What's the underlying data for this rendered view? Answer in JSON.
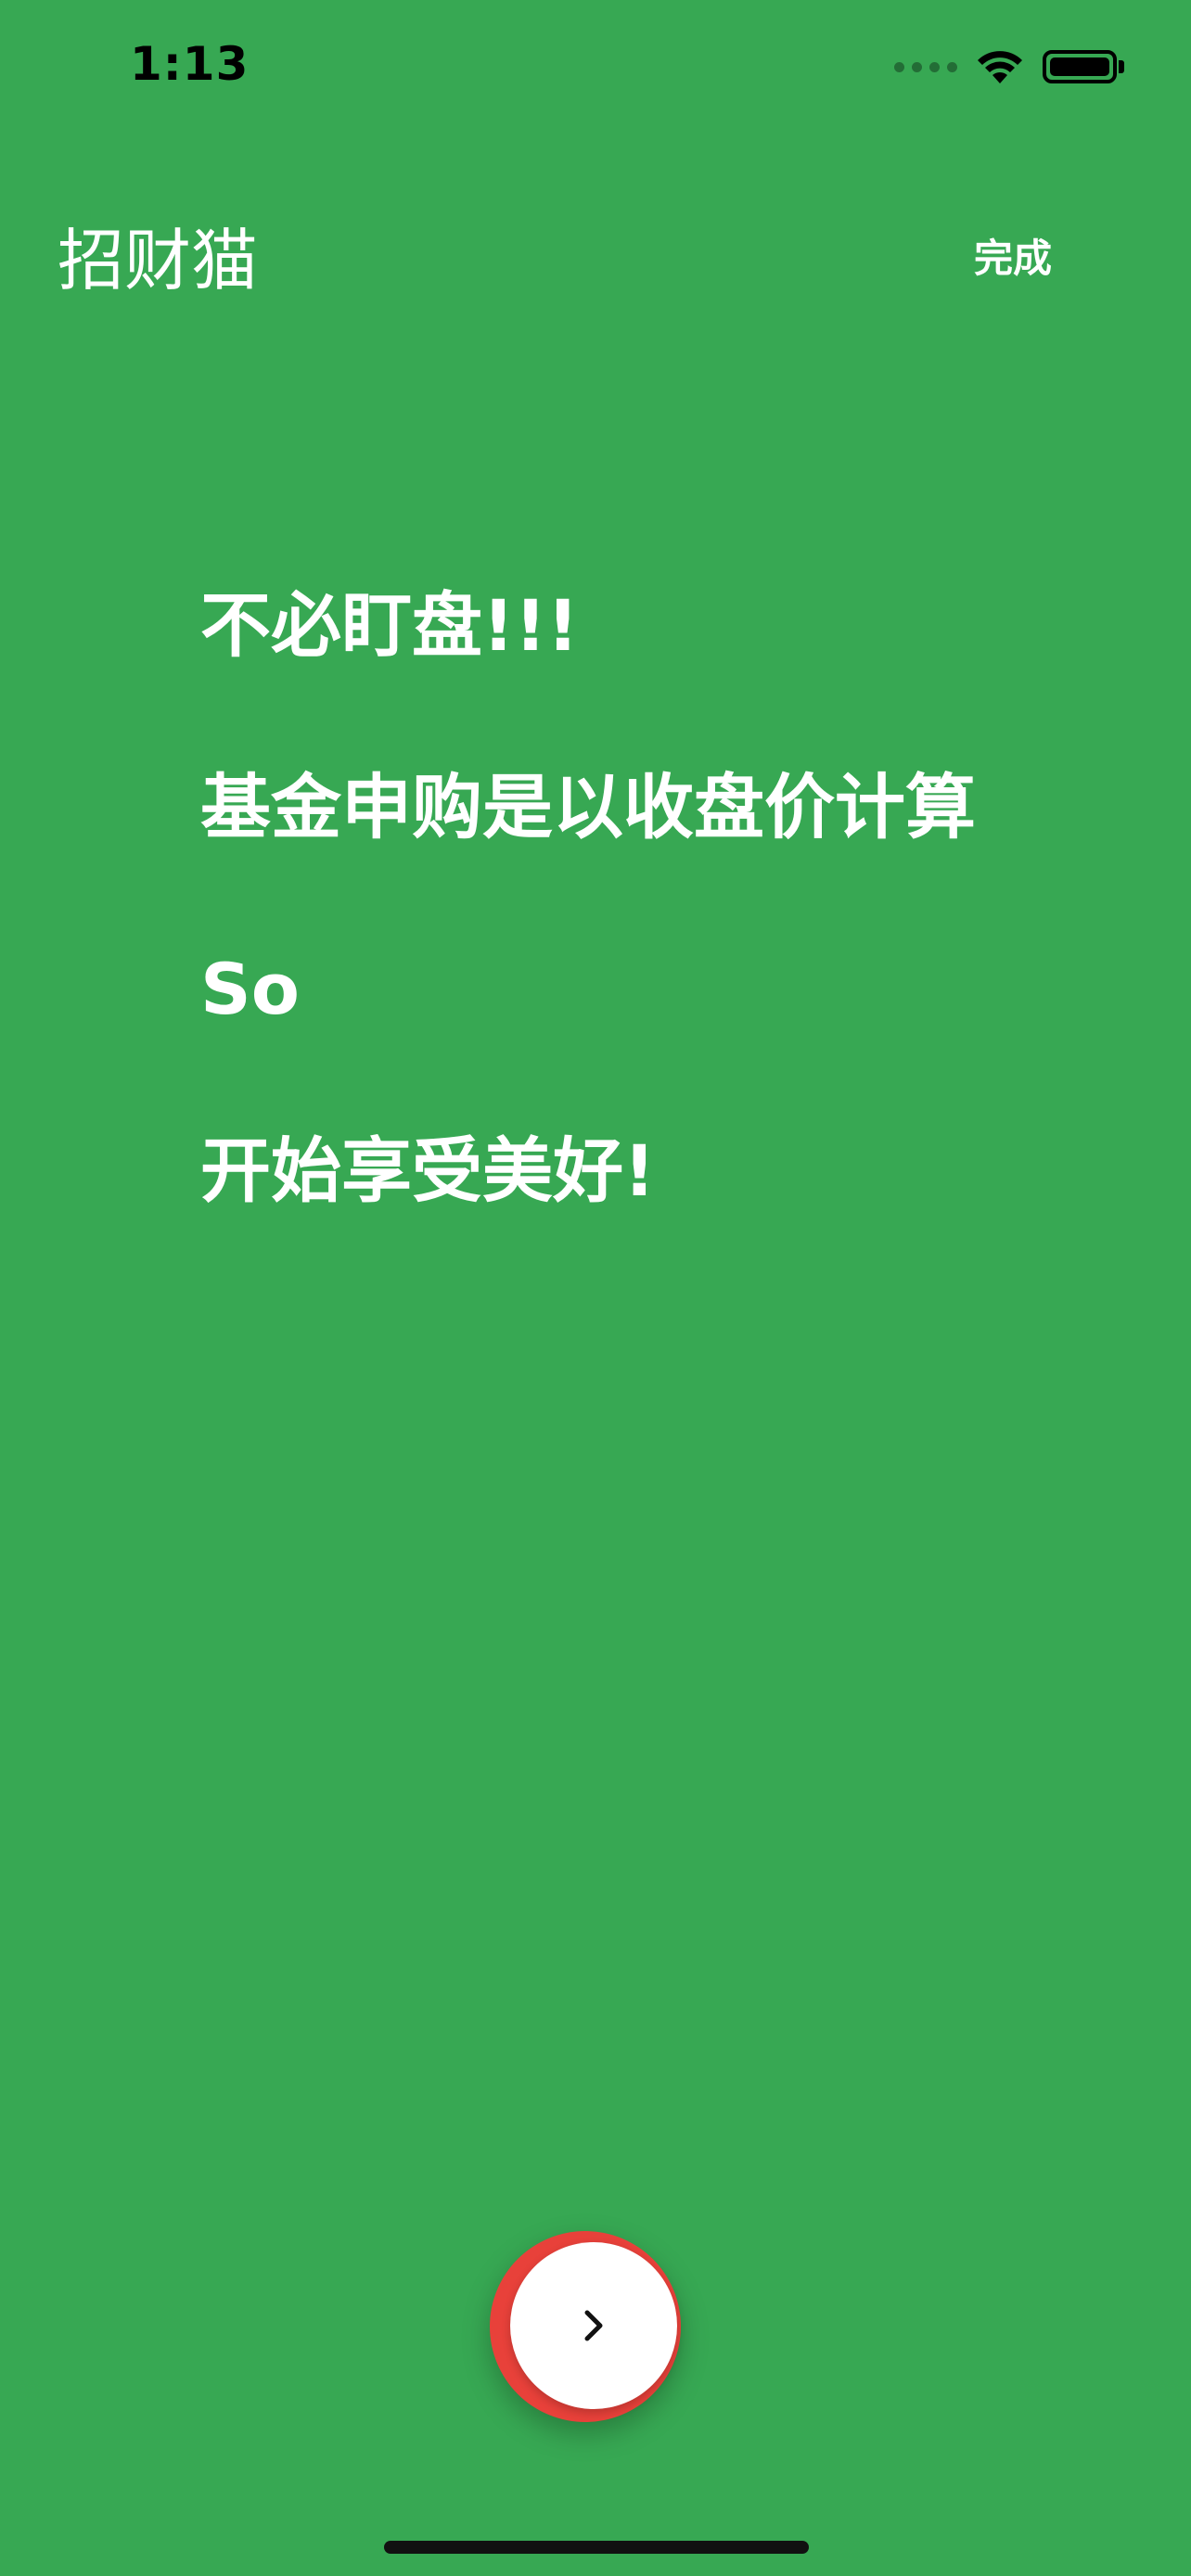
{
  "status_bar": {
    "time": "1:13"
  },
  "nav": {
    "title": "招财猫",
    "done_label": "完成"
  },
  "content": {
    "lines": [
      "不必盯盘!!!",
      "基金申购是以收盘价计算",
      "So",
      "开始享受美好!"
    ]
  },
  "colors": {
    "background": "#37A853",
    "button_ring": "#E8413A",
    "button_face": "#FFFFFF",
    "text": "#FFFFFF"
  },
  "icons": {
    "next": "chevron-right-icon",
    "wifi": "wifi-icon",
    "battery": "battery-icon"
  }
}
